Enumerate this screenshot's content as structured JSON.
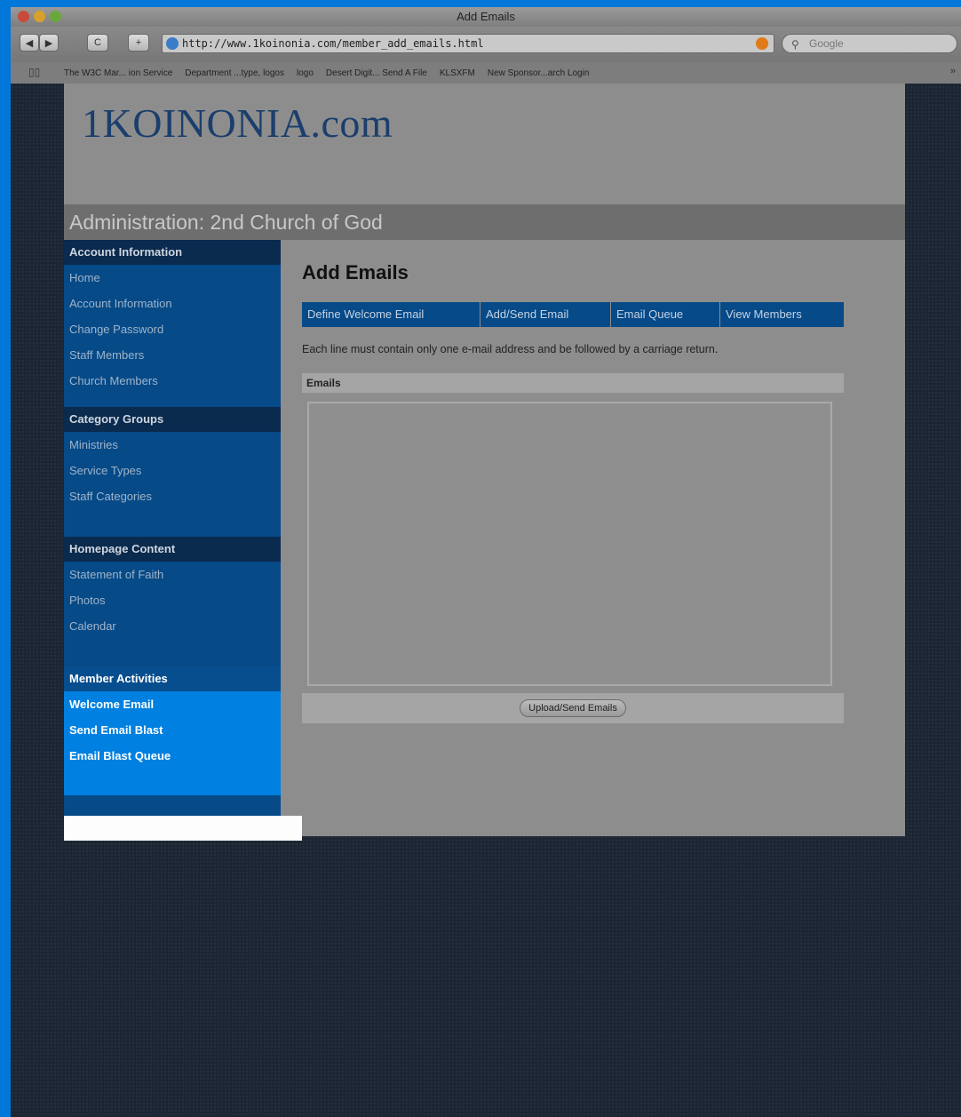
{
  "window": {
    "title": "Add Emails"
  },
  "toolbar": {
    "back_label": "◀",
    "forward_label": "▶",
    "reload_label": "C",
    "add_label": "+",
    "url": "http://www.1koinonia.com/member_add_emails.html",
    "search_placeholder": "Google"
  },
  "bookmarks": [
    "The W3C Mar... ion Service",
    "Department ...type, logos",
    "logo",
    "Desert Digit... Send A File",
    "KLSXFM",
    "New Sponsor...arch Login"
  ],
  "site": {
    "logo": "1KOINONIA.com",
    "admin_title": "Administration: 2nd Church of God"
  },
  "sidebar": {
    "groups": [
      {
        "heading": "Account Information",
        "items": [
          "Home",
          "Account Information",
          "Change Password",
          "Staff Members",
          "Church Members"
        ]
      },
      {
        "heading": "Category Groups",
        "items": [
          "Ministries",
          "Service Types",
          "Staff Categories"
        ]
      },
      {
        "heading": "Homepage Content",
        "items": [
          "Statement of Faith",
          "Photos",
          "Calendar"
        ]
      },
      {
        "heading": "Member Activities",
        "items": [
          "Welcome Email",
          "Send Email Blast",
          "Email Blast Queue"
        ]
      }
    ]
  },
  "main": {
    "title": "Add Emails",
    "tabs": [
      "Define Welcome Email",
      "Add/Send Email",
      "Email Queue",
      "View Members"
    ],
    "instructions": "Each line must contain only one e-mail address and be followed by a carriage return.",
    "emails_label": "Emails",
    "emails_value": "",
    "upload_label": "Upload/Send Emails"
  }
}
